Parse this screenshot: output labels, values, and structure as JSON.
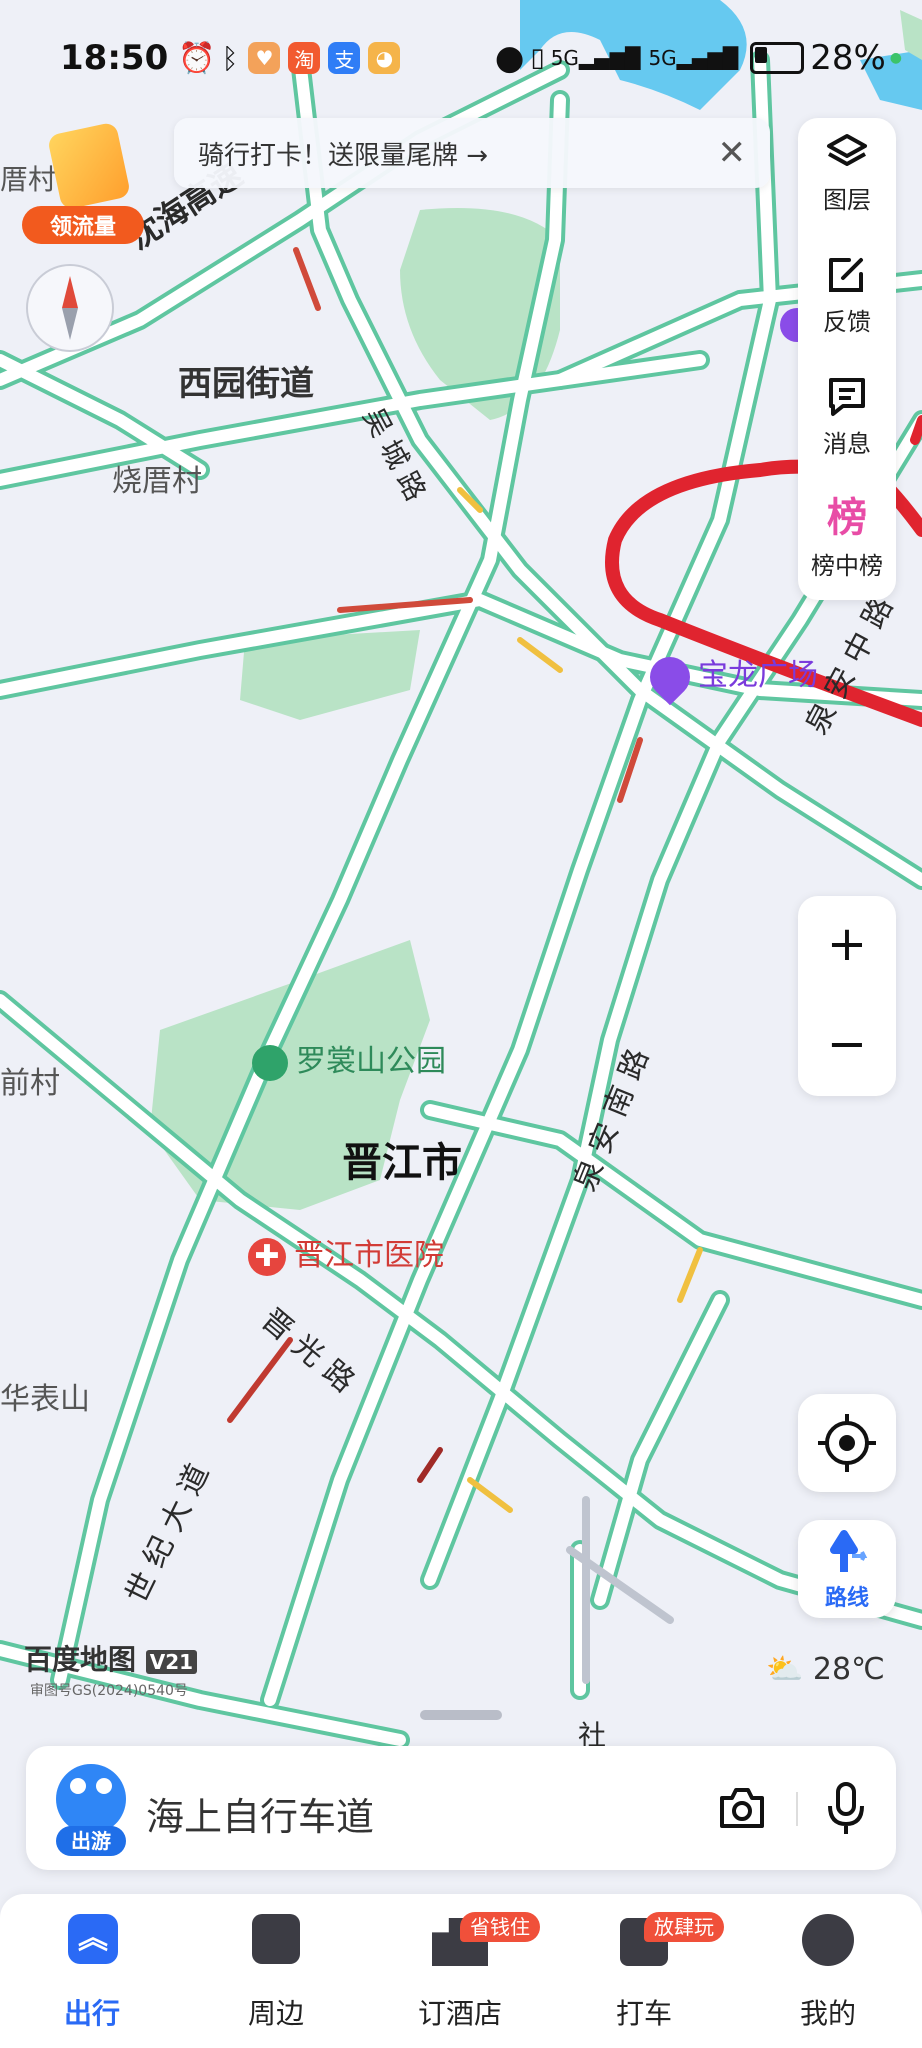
{
  "status_bar": {
    "time": "18:50",
    "battery": "28%"
  },
  "promo_banner": {
    "text": "骑行打卡！送限量尾牌 →"
  },
  "gift": {
    "label": "领流量"
  },
  "map": {
    "place_labels": {
      "xiyuan": "西园街道",
      "shaocuo": "烧厝村",
      "qiancun": "前村",
      "huabiaoshan": "华表山",
      "cuo_village": "厝村",
      "jinjiang": "晋江市",
      "luoshang_park": "罗裳山公园",
      "hospital": "晋江市医院",
      "baolong": "宝龙广场",
      "guang": "广"
    },
    "road_labels": {
      "shenhai": "沈海高速",
      "wucheng": "吴城路",
      "quanan_zhong": "泉安中路",
      "quanan_nan": "泉安南路",
      "jinguang": "晋光路",
      "shiji": "世纪大道",
      "she": "社"
    },
    "brand": {
      "name": "百度地图",
      "version": "V21",
      "license": "审图号GS(2024)0540号"
    },
    "weather": {
      "temp": "28℃"
    }
  },
  "side_tools": {
    "layers": "图层",
    "feedback": "反馈",
    "messages": "消息",
    "ranking_icon": "榜",
    "ranking": "榜中榜"
  },
  "zoom": {
    "in": "+",
    "out": "−"
  },
  "route_button": {
    "label": "路线"
  },
  "search": {
    "placeholder": "海上自行车道",
    "avatar_tag": "出游"
  },
  "tabs": [
    {
      "label": "出行",
      "active": true
    },
    {
      "label": "周边"
    },
    {
      "label": "订酒店",
      "badge": "省钱住"
    },
    {
      "label": "打车",
      "badge": "放肆玩"
    },
    {
      "label": "我的"
    }
  ],
  "colors": {
    "road": "#5fc6a0",
    "water": "#66c9f0",
    "park": "#b9e3c6",
    "accent": "#2a6af5",
    "annotation": "#e0242f"
  }
}
